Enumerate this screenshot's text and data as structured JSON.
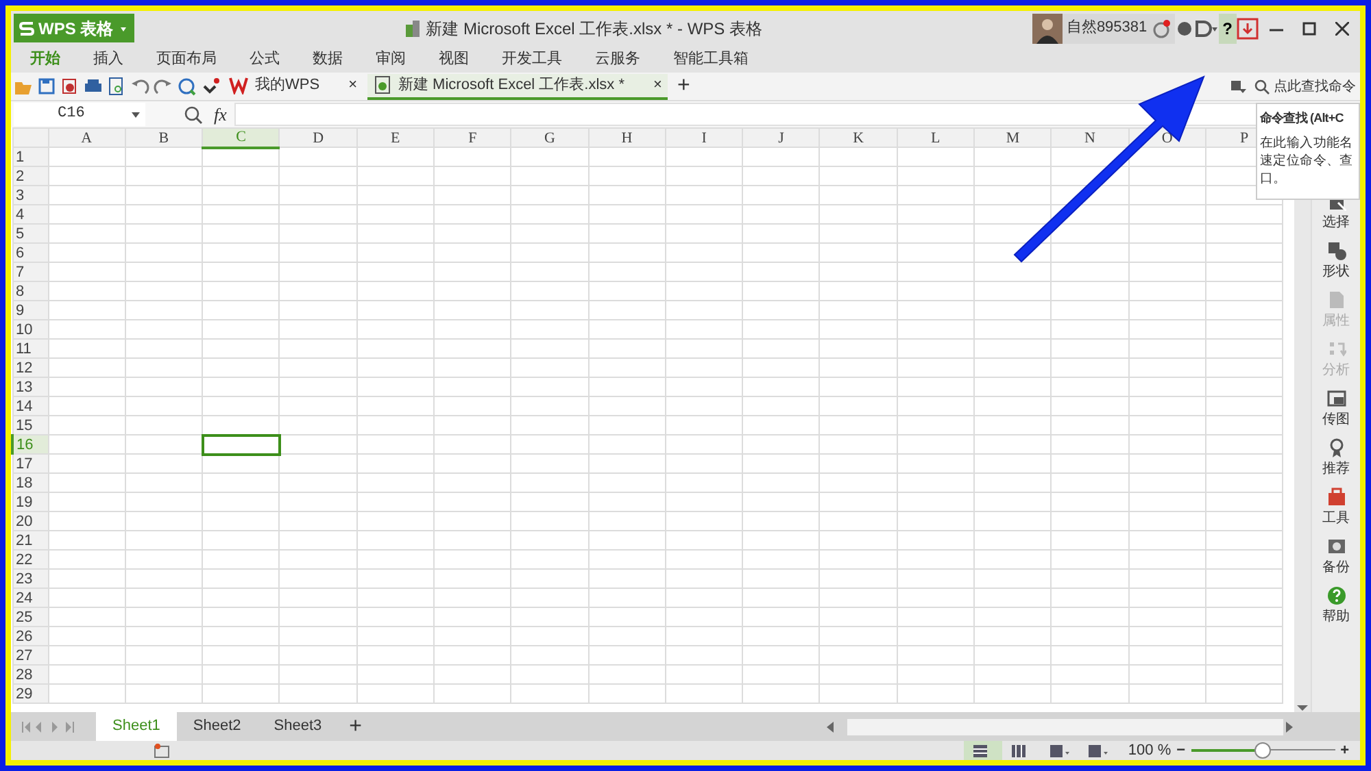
{
  "app_menu": {
    "label": "WPS 表格"
  },
  "window": {
    "title": "新建 Microsoft Excel 工作表.xlsx * - WPS 表格"
  },
  "account": {
    "user": "自然895381"
  },
  "help_button": {
    "label": "?",
    "selected": true
  },
  "ribbon_tabs": [
    {
      "label": "开始",
      "selected": true
    },
    {
      "label": "插入",
      "selected": false
    },
    {
      "label": "页面布局",
      "selected": false
    },
    {
      "label": "公式",
      "selected": false
    },
    {
      "label": "数据",
      "selected": false
    },
    {
      "label": "审阅",
      "selected": false
    },
    {
      "label": "视图",
      "selected": false
    },
    {
      "label": "开发工具",
      "selected": false
    },
    {
      "label": "云服务",
      "selected": false
    },
    {
      "label": "智能工具箱",
      "selected": false
    }
  ],
  "doc_tabs": [
    {
      "kind": "home",
      "label": "我的WPS",
      "close": "×",
      "selected": false
    },
    {
      "kind": "sheet",
      "label": "新建 Microsoft Excel 工作表.xlsx *",
      "close": "×",
      "selected": true
    }
  ],
  "new_doc_tab": "+",
  "command_search": {
    "placeholder": "点此查找命令"
  },
  "tooltip": {
    "title": "命令查找 (Alt+C",
    "lines": [
      "在此输入功能名",
      "速定位命令、查",
      "口。"
    ]
  },
  "name_box": {
    "value": "C16"
  },
  "formula_bar": {
    "label": "fx"
  },
  "sheet": {
    "columns": [
      {
        "label": "A",
        "selected": false
      },
      {
        "label": "B",
        "selected": false
      },
      {
        "label": "C",
        "selected": true
      },
      {
        "label": "D",
        "selected": false
      },
      {
        "label": "E",
        "selected": false
      },
      {
        "label": "F",
        "selected": false
      },
      {
        "label": "G",
        "selected": false
      },
      {
        "label": "H",
        "selected": false
      },
      {
        "label": "I",
        "selected": false
      },
      {
        "label": "J",
        "selected": false
      },
      {
        "label": "K",
        "selected": false
      },
      {
        "label": "L",
        "selected": false
      },
      {
        "label": "M",
        "selected": false
      },
      {
        "label": "N",
        "selected": false
      },
      {
        "label": "O",
        "selected": false
      },
      {
        "label": "P",
        "selected": false
      }
    ],
    "rows": [
      {
        "label": "1",
        "selected": false
      },
      {
        "label": "2",
        "selected": false
      },
      {
        "label": "3",
        "selected": false
      },
      {
        "label": "4",
        "selected": false
      },
      {
        "label": "5",
        "selected": false
      },
      {
        "label": "6",
        "selected": false
      },
      {
        "label": "7",
        "selected": false
      },
      {
        "label": "8",
        "selected": false
      },
      {
        "label": "9",
        "selected": false
      },
      {
        "label": "10",
        "selected": false
      },
      {
        "label": "11",
        "selected": false
      },
      {
        "label": "12",
        "selected": false
      },
      {
        "label": "13",
        "selected": false
      },
      {
        "label": "14",
        "selected": false
      },
      {
        "label": "15",
        "selected": false
      },
      {
        "label": "16",
        "selected": true
      },
      {
        "label": "17",
        "selected": false
      },
      {
        "label": "18",
        "selected": false
      },
      {
        "label": "19",
        "selected": false
      },
      {
        "label": "20",
        "selected": false
      },
      {
        "label": "21",
        "selected": false
      },
      {
        "label": "22",
        "selected": false
      },
      {
        "label": "23",
        "selected": false
      },
      {
        "label": "24",
        "selected": false
      },
      {
        "label": "25",
        "selected": false
      },
      {
        "label": "26",
        "selected": false
      },
      {
        "label": "27",
        "selected": false
      },
      {
        "label": "28",
        "selected": false
      },
      {
        "label": "29",
        "selected": false
      }
    ]
  },
  "sidebar": [
    {
      "kind": "select",
      "label": "选择",
      "disabled": false
    },
    {
      "kind": "shape",
      "label": "形状",
      "disabled": false
    },
    {
      "kind": "props",
      "label": "属性",
      "disabled": true
    },
    {
      "kind": "analyze",
      "label": "分析",
      "disabled": true
    },
    {
      "kind": "image",
      "label": "传图",
      "disabled": false
    },
    {
      "kind": "recommend",
      "label": "推荐",
      "disabled": false
    },
    {
      "kind": "tools",
      "label": "工具",
      "disabled": false
    },
    {
      "kind": "backup",
      "label": "备份",
      "disabled": false
    },
    {
      "kind": "help",
      "label": "帮助",
      "disabled": false
    }
  ],
  "sheet_tabs": [
    {
      "label": "Sheet1",
      "selected": true
    },
    {
      "label": "Sheet2",
      "selected": false
    },
    {
      "label": "Sheet3",
      "selected": false
    }
  ],
  "new_sheet": "+",
  "status_bar": {
    "views": [
      {
        "kind": "normal",
        "selected": true
      },
      {
        "kind": "page_break",
        "selected": false
      },
      {
        "kind": "layout",
        "selected": false
      },
      {
        "kind": "eye",
        "selected": false
      }
    ],
    "zoom": "100 %",
    "zoom_out": "−",
    "zoom_in": "+",
    "zoom_slider": {
      "level": 0.5
    }
  }
}
